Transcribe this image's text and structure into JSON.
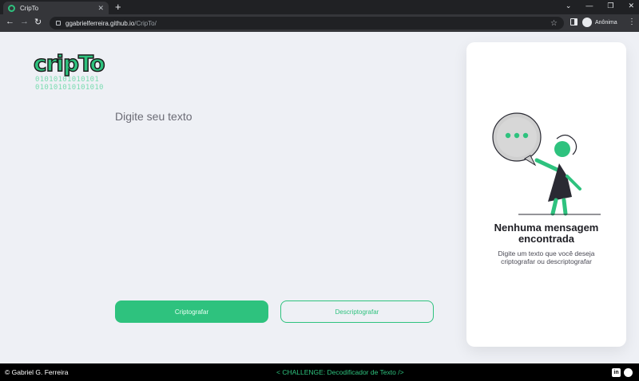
{
  "browser": {
    "tab_title": "CripTo",
    "new_tab_glyph": "+",
    "url_host": "ggabrielferreira.github.io",
    "url_path": "/CripTo/",
    "profile_label": "Anônima",
    "icons": [
      "back-arrow-icon",
      "forward-arrow-icon",
      "reload-icon",
      "lock-icon",
      "star-icon",
      "side-panel-icon",
      "incognito-icon",
      "kebab-menu-icon"
    ]
  },
  "logo": {
    "text": "cripTo",
    "binary_line_1": "01010101010101",
    "binary_line_2": "010101010101010"
  },
  "input": {
    "placeholder": "Digite seu texto",
    "value": ""
  },
  "buttons": {
    "encrypt_label": "Criptografar",
    "decrypt_label": "Descriptografar"
  },
  "result_panel": {
    "title": "Nenhuma mensagem encontrada",
    "description": "Digite um texto que você deseja criptografar ou descriptografar"
  },
  "footer": {
    "author": "© Gabriel G. Ferreira",
    "challenge": "< CHALLENGE: Decodificador de Texto />",
    "icons": [
      "linkedin-icon",
      "github-icon"
    ]
  },
  "colors": {
    "accent": "#2ec27e",
    "page_bg": "#eef0f5",
    "card_bg": "#ffffff",
    "footer_bg": "#000000"
  }
}
